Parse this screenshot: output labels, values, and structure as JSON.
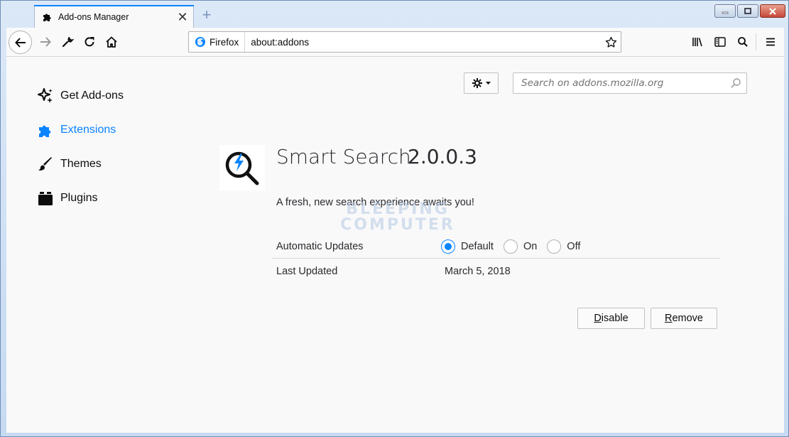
{
  "window": {
    "tab_title": "Add-ons Manager",
    "tab_close_glyph": "✕",
    "new_tab_glyph": "+"
  },
  "navbar": {
    "identity_label": "Firefox",
    "url": "about:addons"
  },
  "sidebar": {
    "items": [
      {
        "label": "Get Add-ons",
        "icon": "sparkle-icon",
        "selected": false
      },
      {
        "label": "Extensions",
        "icon": "puzzle-icon",
        "selected": true
      },
      {
        "label": "Themes",
        "icon": "brush-icon",
        "selected": false
      },
      {
        "label": "Plugins",
        "icon": "plugin-icon",
        "selected": false
      }
    ]
  },
  "search": {
    "placeholder": "Search on addons.mozilla.org"
  },
  "addon": {
    "name": "Smart Search",
    "version": "2.0.0.3",
    "description": "A fresh, new search experience awaits you!",
    "automatic_updates_label": "Automatic Updates",
    "update_options": [
      "Default",
      "On",
      "Off"
    ],
    "update_selected": "Default",
    "last_updated_label": "Last Updated",
    "last_updated_value": "March 5, 2018",
    "disable_label": "Disable",
    "remove_label": "Remove"
  },
  "watermark": {
    "line1": "BLEEPING",
    "line2": "COMPUTER"
  },
  "colors": {
    "accent": "#0a84ff",
    "text": "#0c0c0d",
    "content_bg": "#f9f9fa"
  }
}
